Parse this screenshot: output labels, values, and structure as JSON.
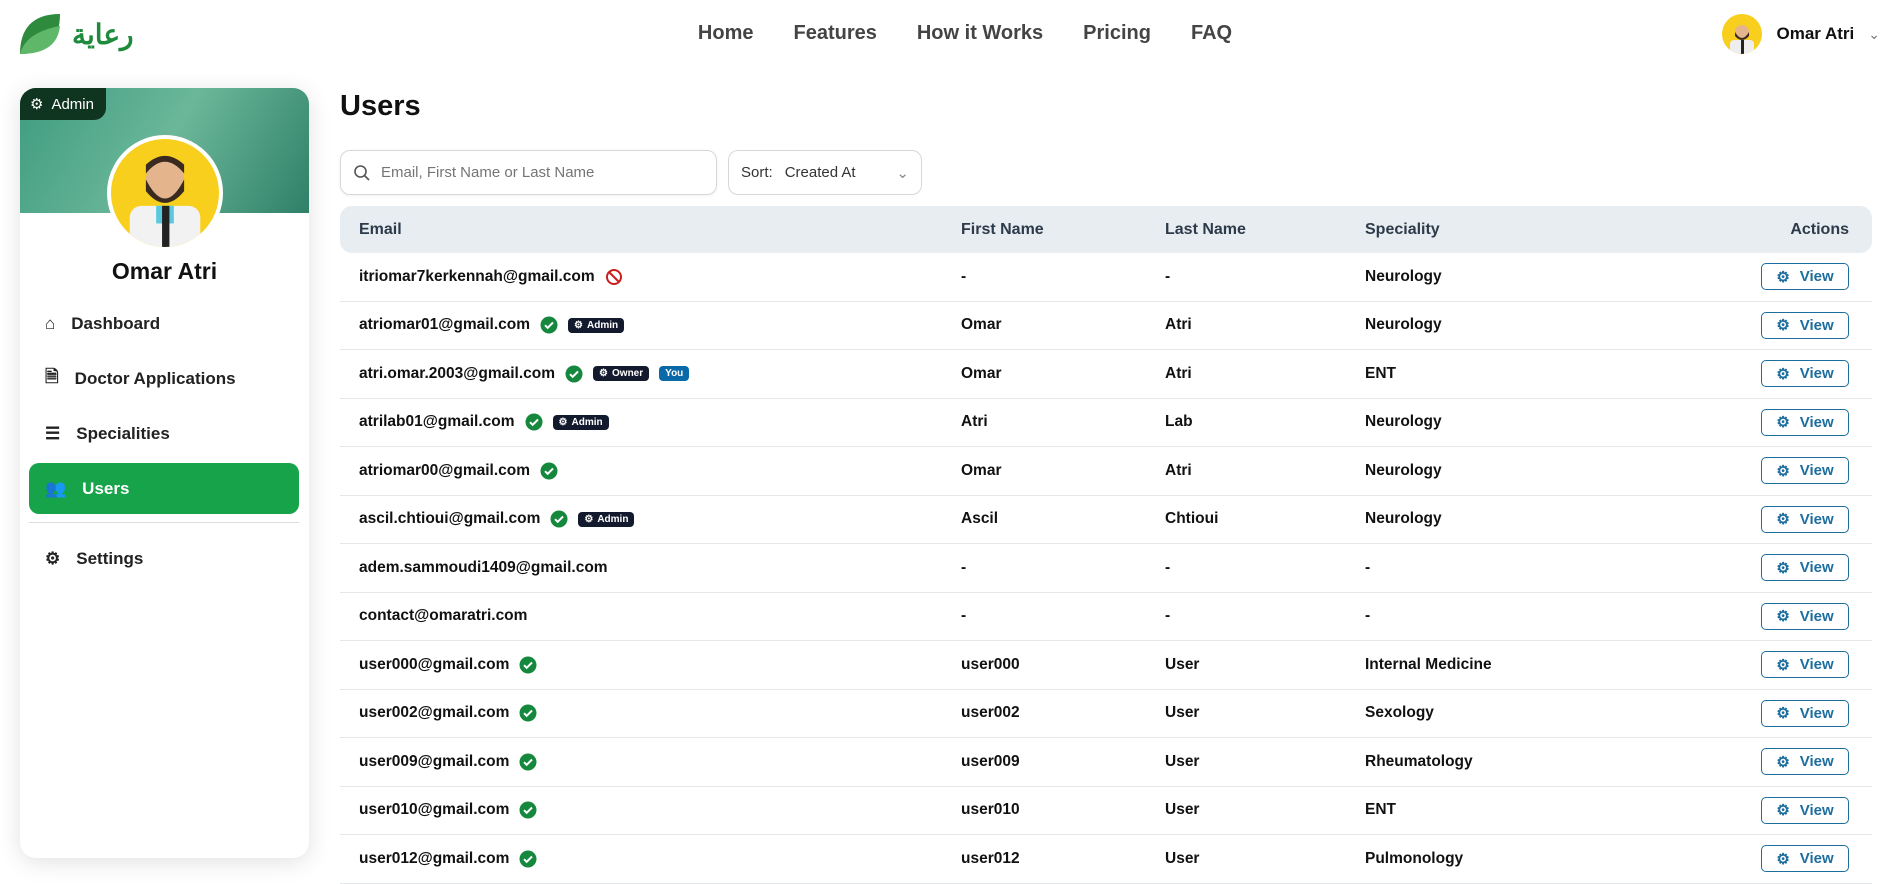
{
  "brand": {
    "name": "رعاية",
    "color": "#1f8a3c"
  },
  "nav": [
    "Home",
    "Features",
    "How it Works",
    "Pricing",
    "FAQ"
  ],
  "user": {
    "name": "Omar Atri"
  },
  "sidebar": {
    "role": "Admin",
    "name": "Omar Atri",
    "items": [
      {
        "label": "Dashboard",
        "icon": "home-icon"
      },
      {
        "label": "Doctor Applications",
        "icon": "document-check-icon"
      },
      {
        "label": "Specialities",
        "icon": "list-icon"
      },
      {
        "label": "Users",
        "icon": "users-icon",
        "active": true
      },
      {
        "label": "Settings",
        "icon": "gear-icon"
      }
    ],
    "accent": "#16a34a"
  },
  "page": {
    "title": "Users",
    "search_placeholder": "Email, First Name or Last Name",
    "sort_label": "Sort:",
    "sort_value": "Created At"
  },
  "table": {
    "headers": [
      "Email",
      "First Name",
      "Last Name",
      "Speciality",
      "Actions"
    ],
    "view_label": "View",
    "rows": [
      {
        "email": "itriomar7kerkennah@gmail.com",
        "status": "banned",
        "badges": [],
        "first": "-",
        "last": "-",
        "speciality": "Neurology"
      },
      {
        "email": "atriomar01@gmail.com",
        "status": "verified",
        "badges": [
          "Admin"
        ],
        "first": "Omar",
        "last": "Atri",
        "speciality": "Neurology"
      },
      {
        "email": "atri.omar.2003@gmail.com",
        "status": "verified",
        "badges": [
          "Owner"
        ],
        "you": "You",
        "first": "Omar",
        "last": "Atri",
        "speciality": "ENT"
      },
      {
        "email": "atrilab01@gmail.com",
        "status": "verified",
        "badges": [
          "Admin"
        ],
        "first": "Atri",
        "last": "Lab",
        "speciality": "Neurology"
      },
      {
        "email": "atriomar00@gmail.com",
        "status": "verified",
        "badges": [],
        "first": "Omar",
        "last": "Atri",
        "speciality": "Neurology"
      },
      {
        "email": "ascil.chtioui@gmail.com",
        "status": "verified",
        "badges": [
          "Admin"
        ],
        "first": "Ascil",
        "last": "Chtioui",
        "speciality": "Neurology"
      },
      {
        "email": "adem.sammoudi1409@gmail.com",
        "status": "none",
        "badges": [],
        "first": "-",
        "last": "-",
        "speciality": "-"
      },
      {
        "email": "contact@omaratri.com",
        "status": "none",
        "badges": [],
        "first": "-",
        "last": "-",
        "speciality": "-"
      },
      {
        "email": "user000@gmail.com",
        "status": "verified",
        "badges": [],
        "first": "user000",
        "last": "User",
        "speciality": "Internal Medicine"
      },
      {
        "email": "user002@gmail.com",
        "status": "verified",
        "badges": [],
        "first": "user002",
        "last": "User",
        "speciality": "Sexology"
      },
      {
        "email": "user009@gmail.com",
        "status": "verified",
        "badges": [],
        "first": "user009",
        "last": "User",
        "speciality": "Rheumatology"
      },
      {
        "email": "user010@gmail.com",
        "status": "verified",
        "badges": [],
        "first": "user010",
        "last": "User",
        "speciality": "ENT"
      },
      {
        "email": "user012@gmail.com",
        "status": "verified",
        "badges": [],
        "first": "user012",
        "last": "User",
        "speciality": "Pulmonology"
      }
    ]
  }
}
